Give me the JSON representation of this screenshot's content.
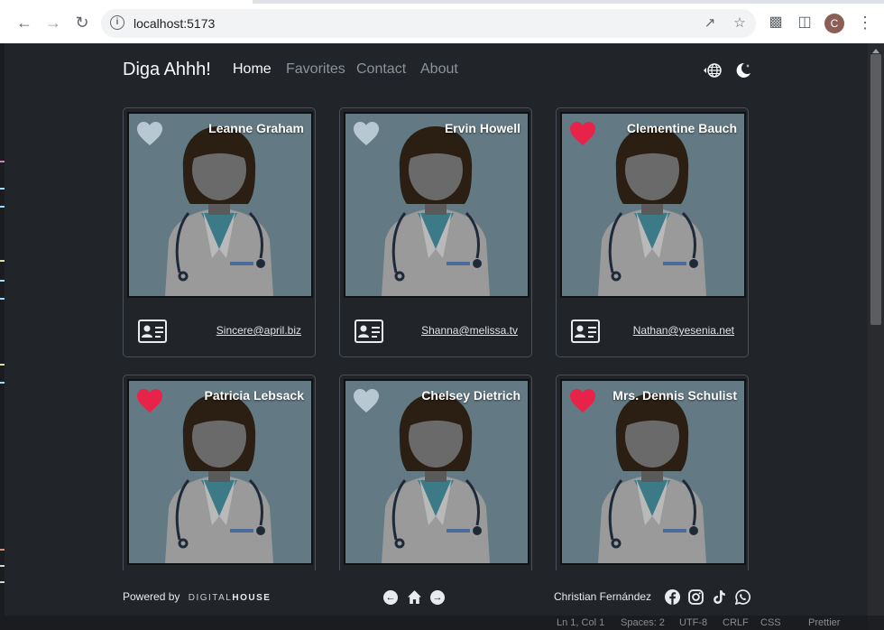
{
  "browser": {
    "url": "localhost:5173",
    "avatar_letter": "C"
  },
  "nav": {
    "brand": "Diga Ahhh!",
    "links": [
      "Home",
      "Favorites",
      "Contact",
      "About"
    ],
    "active": "Home"
  },
  "cards": [
    {
      "name": "Leanne Graham",
      "email": "Sincere@april.biz",
      "favorite": false
    },
    {
      "name": "Ervin Howell",
      "email": "Shanna@melissa.tv",
      "favorite": false
    },
    {
      "name": "Clementine Bauch",
      "email": "Nathan@yesenia.net",
      "favorite": true
    },
    {
      "name": "Patricia Lebsack",
      "email": "",
      "favorite": true
    },
    {
      "name": "Chelsey Dietrich",
      "email": "",
      "favorite": false
    },
    {
      "name": "Mrs. Dennis Schulist",
      "email": "",
      "favorite": true
    }
  ],
  "footer": {
    "powered_by": "Powered by",
    "brand_light": "DIGITAL",
    "brand_bold": "HOUSE",
    "author": "Christian Fernández"
  },
  "statusbar": [
    "Ln 1, Col 1",
    "Spaces: 2",
    "UTF-8",
    "CRLF",
    "CSS",
    "Prettier"
  ],
  "colors": {
    "background": "#212529",
    "heart_favorite": "#e8234a",
    "heart_default": "#b8c8d2",
    "photo_bg": "#637a84"
  }
}
